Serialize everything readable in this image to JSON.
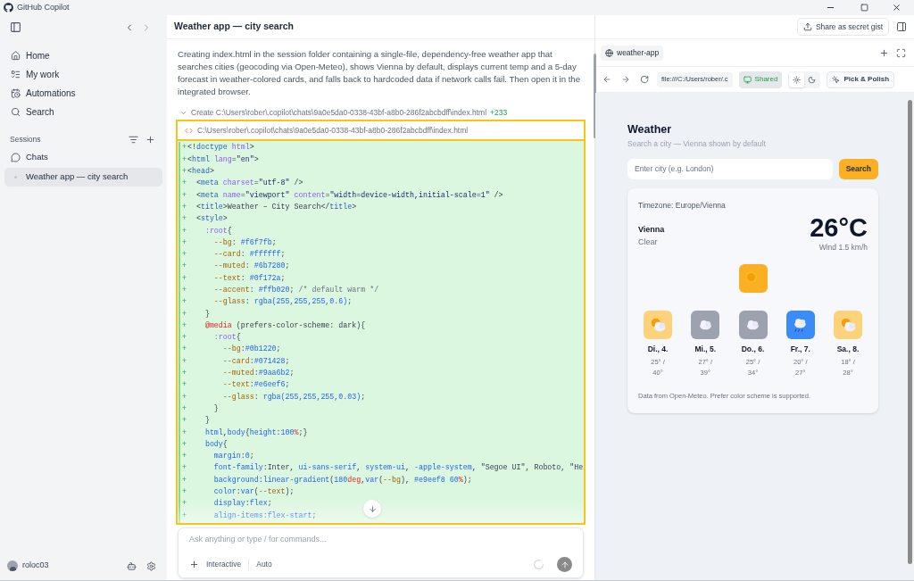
{
  "window": {
    "title": "GitHub Copilot"
  },
  "sidebar": {
    "nav": [
      {
        "label": "Home",
        "kind": "home",
        "selected": false
      },
      {
        "label": "My work",
        "kind": "tasks",
        "selected": false
      },
      {
        "label": "Automations",
        "kind": "calendar",
        "selected": false
      },
      {
        "label": "Search",
        "kind": "search",
        "selected": false
      }
    ],
    "sessions_label": "Sessions",
    "sessions": [
      {
        "label": "Chats",
        "kind": "group",
        "selected": false
      },
      {
        "label": "Weather app — city search",
        "kind": "session",
        "selected": true
      }
    ],
    "user": {
      "name": "roloc03"
    }
  },
  "chat": {
    "title": "Weather app — city search",
    "message": "Creating index.html in the session folder containing a single-file, dependency-free weather app that searches cities (geocoding via Open-Meteo), shows Vienna by default, displays current temp and a 5-day forecast in weather-colored cards, and falls back to hardcoded data if network calls fail. Then open it in the integrated browser.",
    "file_op": {
      "action": "Create C:\\Users\\rober\\.copilot\\chats\\9a0e5da0-0338-43bf-a8b0-286f2abcbdff\\index.html",
      "added": "+233",
      "expanded": true
    },
    "file_path": "C:\\Users\\rober\\.copilot\\chats\\9a0e5da0-0338-43bf-a8b0-286f2abcbdff\\index.html",
    "code_lines": [
      {
        "marker": "+",
        "tokens": [
          {
            "kind": "plain",
            "text": "<!"
          },
          {
            "kind": "tag",
            "text": "doctype"
          },
          {
            "kind": "attr",
            "text": " html"
          },
          {
            "kind": "plain",
            "text": ">"
          }
        ]
      },
      {
        "marker": "+",
        "tokens": [
          {
            "kind": "plain",
            "text": "<"
          },
          {
            "kind": "tag",
            "text": "html"
          },
          {
            "kind": "attr",
            "text": " lang"
          },
          {
            "kind": "plain",
            "text": "="
          },
          {
            "kind": "string",
            "text": "\"en\""
          },
          {
            "kind": "plain",
            "text": ">"
          }
        ]
      },
      {
        "marker": "+",
        "tokens": [
          {
            "kind": "plain",
            "text": "<"
          },
          {
            "kind": "tag",
            "text": "head"
          },
          {
            "kind": "plain",
            "text": ">"
          }
        ]
      },
      {
        "marker": "+",
        "tokens": [
          {
            "kind": "plain",
            "text": "  <"
          },
          {
            "kind": "tag",
            "text": "meta"
          },
          {
            "kind": "attr",
            "text": " charset"
          },
          {
            "kind": "plain",
            "text": "="
          },
          {
            "kind": "string",
            "text": "\"utf-8\""
          },
          {
            "kind": "plain",
            "text": " />"
          }
        ]
      },
      {
        "marker": "+",
        "tokens": [
          {
            "kind": "plain",
            "text": "  <"
          },
          {
            "kind": "tag",
            "text": "meta"
          },
          {
            "kind": "attr",
            "text": " name"
          },
          {
            "kind": "plain",
            "text": "="
          },
          {
            "kind": "string",
            "text": "\"viewport\""
          },
          {
            "kind": "attr",
            "text": " content"
          },
          {
            "kind": "plain",
            "text": "="
          },
          {
            "kind": "string",
            "text": "\"width=device-width,initial-scale=1\""
          },
          {
            "kind": "plain",
            "text": " />"
          }
        ]
      },
      {
        "marker": "+",
        "tokens": [
          {
            "kind": "plain",
            "text": "  <"
          },
          {
            "kind": "tag",
            "text": "title"
          },
          {
            "kind": "plain",
            "text": ">Weather – City Search</"
          },
          {
            "kind": "tag",
            "text": "title"
          },
          {
            "kind": "plain",
            "text": ">"
          }
        ]
      },
      {
        "marker": "+",
        "tokens": [
          {
            "kind": "plain",
            "text": "  <"
          },
          {
            "kind": "tag",
            "text": "style"
          },
          {
            "kind": "plain",
            "text": ">"
          }
        ]
      },
      {
        "marker": "+",
        "tokens": [
          {
            "kind": "attr",
            "text": "    :root"
          },
          {
            "kind": "plain",
            "text": "{"
          }
        ]
      },
      {
        "marker": "+",
        "tokens": [
          {
            "kind": "prop",
            "text": "      --bg"
          },
          {
            "kind": "plain",
            "text": ": "
          },
          {
            "kind": "value",
            "text": "#f6f7fb"
          },
          {
            "kind": "plain",
            "text": ";"
          }
        ]
      },
      {
        "marker": "+",
        "tokens": [
          {
            "kind": "prop",
            "text": "      --card"
          },
          {
            "kind": "plain",
            "text": ": "
          },
          {
            "kind": "value",
            "text": "#ffffff"
          },
          {
            "kind": "plain",
            "text": ";"
          }
        ]
      },
      {
        "marker": "+",
        "tokens": [
          {
            "kind": "prop",
            "text": "      --muted"
          },
          {
            "kind": "plain",
            "text": ": "
          },
          {
            "kind": "value",
            "text": "#6b7280"
          },
          {
            "kind": "plain",
            "text": ";"
          }
        ]
      },
      {
        "marker": "+",
        "tokens": [
          {
            "kind": "prop",
            "text": "      --text"
          },
          {
            "kind": "plain",
            "text": ": "
          },
          {
            "kind": "value",
            "text": "#0f172a"
          },
          {
            "kind": "plain",
            "text": ";"
          }
        ]
      },
      {
        "marker": "+",
        "tokens": [
          {
            "kind": "prop",
            "text": "      --accent"
          },
          {
            "kind": "plain",
            "text": ": "
          },
          {
            "kind": "value",
            "text": "#ffb020"
          },
          {
            "kind": "plain",
            "text": "; "
          },
          {
            "kind": "comment",
            "text": "/* default warm */"
          }
        ]
      },
      {
        "marker": "+",
        "tokens": [
          {
            "kind": "prop",
            "text": "      --glass"
          },
          {
            "kind": "plain",
            "text": ": "
          },
          {
            "kind": "value",
            "text": "rgba(255,255,255,0.6)"
          },
          {
            "kind": "plain",
            "text": ";"
          }
        ]
      },
      {
        "marker": "+",
        "tokens": [
          {
            "kind": "plain",
            "text": "    }"
          }
        ]
      },
      {
        "marker": "+",
        "tokens": [
          {
            "kind": "keyword",
            "text": "    @media"
          },
          {
            "kind": "plain",
            "text": " (prefers-color-scheme: dark){"
          }
        ]
      },
      {
        "marker": "+",
        "tokens": [
          {
            "kind": "attr",
            "text": "      :root"
          },
          {
            "kind": "plain",
            "text": "{"
          }
        ]
      },
      {
        "marker": "+",
        "tokens": [
          {
            "kind": "prop",
            "text": "        --bg"
          },
          {
            "kind": "plain",
            "text": ":"
          },
          {
            "kind": "value",
            "text": "#0b1220"
          },
          {
            "kind": "plain",
            "text": ";"
          }
        ]
      },
      {
        "marker": "+",
        "tokens": [
          {
            "kind": "prop",
            "text": "        --card"
          },
          {
            "kind": "plain",
            "text": ":"
          },
          {
            "kind": "value",
            "text": "#071428"
          },
          {
            "kind": "plain",
            "text": ";"
          }
        ]
      },
      {
        "marker": "+",
        "tokens": [
          {
            "kind": "prop",
            "text": "        --muted"
          },
          {
            "kind": "plain",
            "text": ":"
          },
          {
            "kind": "value",
            "text": "#9aa6b2"
          },
          {
            "kind": "plain",
            "text": ";"
          }
        ]
      },
      {
        "marker": "+",
        "tokens": [
          {
            "kind": "prop",
            "text": "        --text"
          },
          {
            "kind": "plain",
            "text": ":"
          },
          {
            "kind": "value",
            "text": "#e6eef6"
          },
          {
            "kind": "plain",
            "text": ";"
          }
        ]
      },
      {
        "marker": "+",
        "tokens": [
          {
            "kind": "prop",
            "text": "        --glass"
          },
          {
            "kind": "plain",
            "text": ": "
          },
          {
            "kind": "value",
            "text": "rgba(255,255,255,0.03)"
          },
          {
            "kind": "plain",
            "text": ";"
          }
        ]
      },
      {
        "marker": "+",
        "tokens": [
          {
            "kind": "plain",
            "text": "      }"
          }
        ]
      },
      {
        "marker": "+",
        "tokens": [
          {
            "kind": "plain",
            "text": "    }"
          }
        ]
      },
      {
        "marker": "+",
        "tokens": [
          {
            "kind": "value",
            "text": "    html"
          },
          {
            "kind": "plain",
            "text": ","
          },
          {
            "kind": "value",
            "text": "body"
          },
          {
            "kind": "plain",
            "text": "{"
          },
          {
            "kind": "value",
            "text": "height"
          },
          {
            "kind": "plain",
            "text": ":"
          },
          {
            "kind": "value",
            "text": "100"
          },
          {
            "kind": "keyword",
            "text": "%"
          },
          {
            "kind": "plain",
            "text": ";}"
          }
        ]
      },
      {
        "marker": "+",
        "tokens": [
          {
            "kind": "value",
            "text": "    body"
          },
          {
            "kind": "plain",
            "text": "{"
          }
        ]
      },
      {
        "marker": "+",
        "tokens": [
          {
            "kind": "value",
            "text": "      margin"
          },
          {
            "kind": "plain",
            "text": ":"
          },
          {
            "kind": "value",
            "text": "0"
          },
          {
            "kind": "plain",
            "text": ";"
          }
        ]
      },
      {
        "marker": "+",
        "tokens": [
          {
            "kind": "value",
            "text": "      font-family"
          },
          {
            "kind": "plain",
            "text": ":Inter, "
          },
          {
            "kind": "value",
            "text": "ui-sans-serif"
          },
          {
            "kind": "plain",
            "text": ", "
          },
          {
            "kind": "value",
            "text": "system-ui"
          },
          {
            "kind": "plain",
            "text": ", "
          },
          {
            "kind": "value",
            "text": "-apple-system"
          },
          {
            "kind": "plain",
            "text": ", \"Segoe UI\", Roboto, \"He"
          }
        ]
      },
      {
        "marker": "+",
        "tokens": [
          {
            "kind": "value",
            "text": "      background"
          },
          {
            "kind": "plain",
            "text": ":"
          },
          {
            "kind": "value",
            "text": "linear-gradient"
          },
          {
            "kind": "plain",
            "text": "("
          },
          {
            "kind": "value",
            "text": "180"
          },
          {
            "kind": "keyword",
            "text": "deg"
          },
          {
            "kind": "plain",
            "text": ","
          },
          {
            "kind": "value",
            "text": "var"
          },
          {
            "kind": "plain",
            "text": "("
          },
          {
            "kind": "prop",
            "text": "--bg"
          },
          {
            "kind": "plain",
            "text": "), "
          },
          {
            "kind": "value",
            "text": "#e9eef8 60"
          },
          {
            "kind": "keyword",
            "text": "%"
          },
          {
            "kind": "plain",
            "text": ");"
          }
        ]
      },
      {
        "marker": "+",
        "tokens": [
          {
            "kind": "value",
            "text": "      color"
          },
          {
            "kind": "plain",
            "text": ":"
          },
          {
            "kind": "value",
            "text": "var"
          },
          {
            "kind": "plain",
            "text": "("
          },
          {
            "kind": "prop",
            "text": "--text"
          },
          {
            "kind": "plain",
            "text": ");"
          }
        ]
      },
      {
        "marker": "+",
        "tokens": [
          {
            "kind": "value",
            "text": "      display"
          },
          {
            "kind": "plain",
            "text": ":"
          },
          {
            "kind": "value",
            "text": "flex"
          },
          {
            "kind": "plain",
            "text": ";"
          }
        ]
      },
      {
        "marker": "+",
        "tokens": [
          {
            "kind": "value",
            "text": "      align-items"
          },
          {
            "kind": "plain",
            "text": ":"
          },
          {
            "kind": "value",
            "text": "flex-start"
          },
          {
            "kind": "plain",
            "text": ";"
          }
        ]
      }
    ],
    "input": {
      "placeholder": "Ask anything or type / for commands...",
      "mode": "Interactive",
      "model": "Auto"
    }
  },
  "browser": {
    "share_button": "Share as secret gist",
    "tab": "weather-app",
    "url": "file:///C:/Users/rober/.c",
    "shared_button": "Shared",
    "pick_button": "Pick & Polish",
    "theme_options": [
      {
        "kind": "light",
        "selected": true
      },
      {
        "kind": "dark",
        "selected": false
      }
    ],
    "page": {
      "title": "Weather",
      "subtitle": "Search a city — Vienna shown by default",
      "search_placeholder": "Enter city (e.g. London)",
      "search_button": "Search",
      "timezone": "Timezone: Europe/Vienna",
      "city": "Vienna",
      "condition": "Clear",
      "temperature": "26°C",
      "wind": "Wind 1.5 km/h",
      "current": {
        "kind": "sun",
        "color": "#fbb024"
      },
      "forecast": [
        {
          "day": "Di., 4.",
          "temps": "25° / 40°",
          "kind": "sun-cloud",
          "color": "#fcd27a"
        },
        {
          "day": "Mi., 5.",
          "temps": "27° / 39°",
          "kind": "cloud",
          "color": "#9ca3af"
        },
        {
          "day": "Do., 6.",
          "temps": "25° / 34°",
          "kind": "cloud",
          "color": "#9ca3af"
        },
        {
          "day": "Fr., 7.",
          "temps": "20° / 27°",
          "kind": "rain",
          "color": "#3b8cf6"
        },
        {
          "day": "Sa., 8.",
          "temps": "18° / 28°",
          "kind": "sun-cloud",
          "color": "#fcd27a"
        }
      ],
      "footer": "Data from Open-Meteo. Prefer color scheme is supported."
    }
  }
}
